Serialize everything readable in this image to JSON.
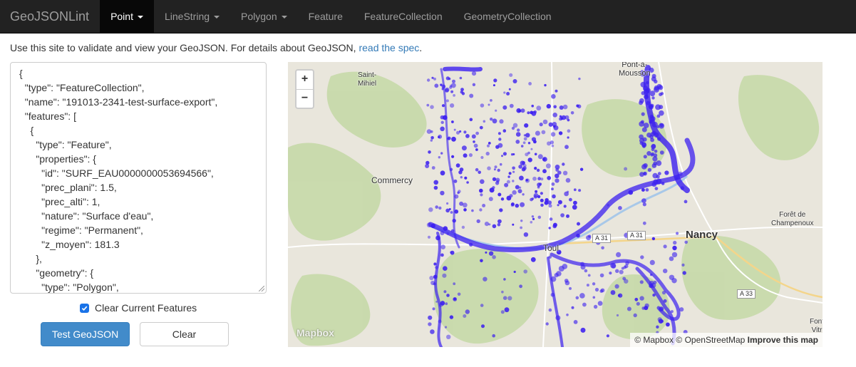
{
  "navbar": {
    "brand": "GeoJSONLint",
    "items": [
      {
        "label": "Point",
        "dropdown": true,
        "active": true
      },
      {
        "label": "LineString",
        "dropdown": true,
        "active": false
      },
      {
        "label": "Polygon",
        "dropdown": true,
        "active": false
      },
      {
        "label": "Feature",
        "dropdown": false,
        "active": false
      },
      {
        "label": "FeatureCollection",
        "dropdown": false,
        "active": false
      },
      {
        "label": "GeometryCollection",
        "dropdown": false,
        "active": false
      }
    ]
  },
  "intro": {
    "text": "Use this site to validate and view your GeoJSON. For details about GeoJSON, ",
    "link": "read the spec",
    "suffix": "."
  },
  "editor": {
    "content": "{\n  \"type\": \"FeatureCollection\",\n  \"name\": \"191013-2341-test-surface-export\",\n  \"features\": [\n    {\n      \"type\": \"Feature\",\n      \"properties\": {\n        \"id\": \"SURF_EAU0000000053694566\",\n        \"prec_plani\": 1.5,\n        \"prec_alti\": 1,\n        \"nature\": \"Surface d'eau\",\n        \"regime\": \"Permanent\",\n        \"z_moyen\": 181.3\n      },\n      \"geometry\": {\n        \"type\": \"Polygon\","
  },
  "options": {
    "clear_label": "Clear Current Features",
    "clear_checked": true
  },
  "buttons": {
    "test": "Test GeoJSON",
    "clear": "Clear"
  },
  "map": {
    "zoom_in": "+",
    "zoom_out": "−",
    "logo": "Mapbox",
    "attribution": {
      "mapbox": "© Mapbox",
      "osm": "© OpenStreetMap",
      "improve": "Improve this map"
    },
    "places": {
      "saint_mihiel": "Saint-\nMihiel",
      "pont_a_mousson": "Pont-à-\nMousson",
      "commercy": "Commercy",
      "nancy": "Nancy",
      "toul": "Toul",
      "foret": "Forêt de\nChampenoux",
      "fontaine": "Font\nVitr"
    },
    "roads": {
      "a31_left": "A 31",
      "a31_right": "A 31",
      "a33": "A 33"
    },
    "colors": {
      "feature": "#3b1ff0",
      "land": "#e9e6dc",
      "forest": "#c6d9a8",
      "water": "#a8c8e8"
    }
  }
}
